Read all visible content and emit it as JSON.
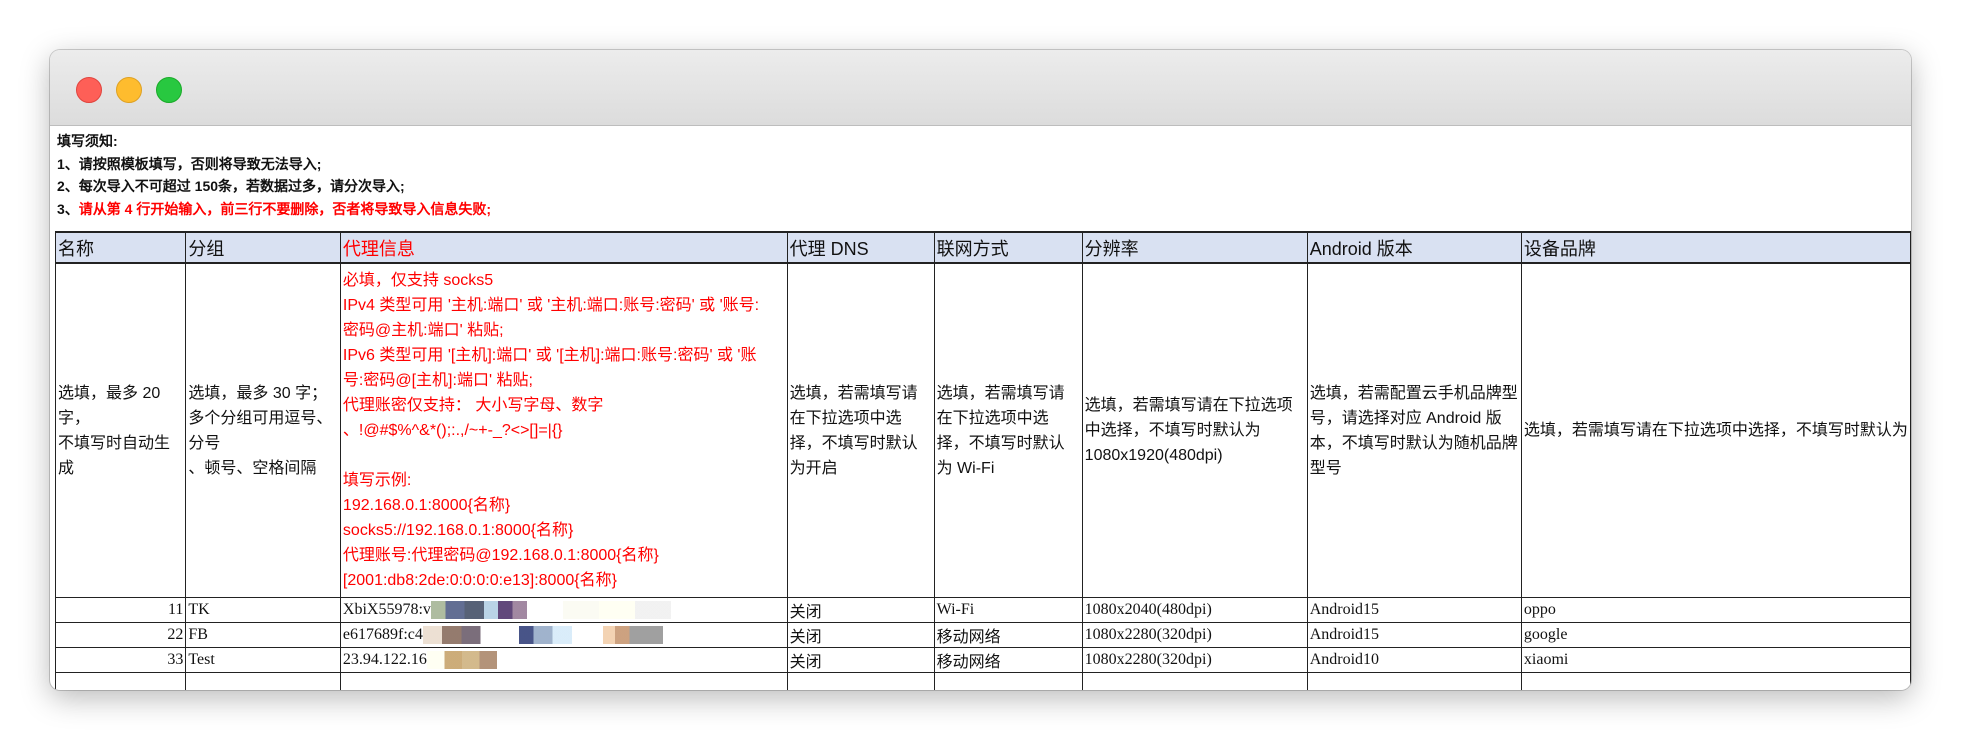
{
  "notes": {
    "title": "填写须知:",
    "line1": "1、请按照模板填写，否则将导致无法导入;",
    "line2": "2、每次导入不可超过 150条，若数据过多，请分次导入;",
    "line3_prefix": "3、",
    "line3": "请从第 4 行开始输入，前三行不要删除，否者将导致导入信息失败;"
  },
  "headers": [
    "名称",
    "分组",
    "代理信息",
    "代理 DNS",
    "联网方式",
    "分辨率",
    "Android 版本",
    "设备品牌"
  ],
  "descriptions": {
    "name": [
      "选填，最多 20 字，",
      "不填写时自动生成"
    ],
    "group": [
      "选填，最多 30 字；",
      "多个分组可用逗号、分号",
      "、顿号、空格间隔"
    ],
    "proxy": [
      "必填，仅支持 socks5",
      "IPv4 类型可用 '主机:端口' 或 '主机:端口:账号:密码' 或 '账号:",
      "密码@主机:端口' 粘贴;",
      "IPv6 类型可用 '[主机]:端口' 或 '[主机]:端口:账号:密码' 或 '账",
      "号:密码@[主机]:端口' 粘贴;",
      "代理账密仅支持：  大小写字母、数字",
      "、!@#$%^&*();:.,/~+-_?<>[]=|{}",
      "",
      "填写示例:",
      "192.168.0.1:8000{名称}",
      "socks5://192.168.0.1:8000{名称}",
      "代理账号:代理密码@192.168.0.1:8000{名称}",
      "[2001:db8:2de:0:0:0:0:e13]:8000{名称}"
    ],
    "dns": "选填，若需填写请在下拉选项中选择，不填写时默认为开启",
    "network": "选填，若需填写请在下拉选项中选择，不填写时默认为 Wi-Fi",
    "resolution": "选填，若需填写请在下拉选项中选择，不填写时默认为 1080x1920(480dpi)",
    "android": "选填，若需配置云手机品牌型号，请选择对应 Android 版本，不填写时默认为随机品牌型号",
    "brand": "选填，若需填写请在下拉选项中选择，不填写时默认为"
  },
  "rows": [
    {
      "name": "11",
      "group": "TK",
      "proxy": "XbiX55978:v",
      "dns": "关闭",
      "network": "Wi-Fi",
      "resolution": "1080x2040(480dpi)",
      "android": "Android15",
      "brand": "oppo"
    },
    {
      "name": "22",
      "group": "FB",
      "proxy": "e617689f:c4",
      "dns": "关闭",
      "network": "移动网络",
      "resolution": "1080x2280(320dpi)",
      "android": "Android15",
      "brand": "google"
    },
    {
      "name": "33",
      "group": "Test",
      "proxy": "23.94.122.16",
      "dns": "关闭",
      "network": "移动网络",
      "resolution": "1080x2280(320dpi)",
      "android": "Android10",
      "brand": "xiaomi"
    }
  ]
}
